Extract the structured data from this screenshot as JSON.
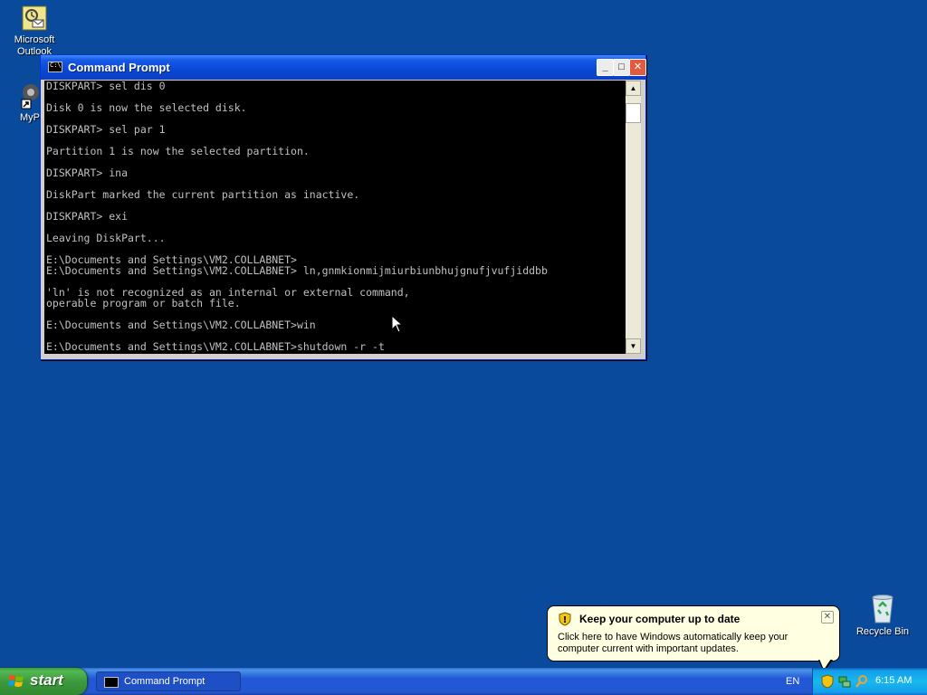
{
  "desktop": {
    "icons": [
      {
        "label": "Microsoft Outlook"
      },
      {
        "label": "MyPa"
      }
    ],
    "recycle_bin": {
      "label": "Recycle Bin"
    }
  },
  "window": {
    "title": "Command Prompt",
    "icon_text": "C:\\",
    "buttons": {
      "minimize": "_",
      "maximize": "□",
      "close": "✕"
    },
    "console_lines": [
      "DISKPART> sel dis 0",
      "",
      "Disk 0 is now the selected disk.",
      "",
      "DISKPART> sel par 1",
      "",
      "Partition 1 is now the selected partition.",
      "",
      "DISKPART> ina",
      "",
      "DiskPart marked the current partition as inactive.",
      "",
      "DISKPART> exi",
      "",
      "Leaving DiskPart...",
      "",
      "E:\\Documents and Settings\\VM2.COLLABNET>",
      "E:\\Documents and Settings\\VM2.COLLABNET> ln,gnmkionmijmiurbiunbhujgnufjvufjiddbb",
      "",
      "'ln' is not recognized as an internal or external command,",
      "operable program or batch file.",
      "",
      "E:\\Documents and Settings\\VM2.COLLABNET>win",
      "",
      "E:\\Documents and Settings\\VM2.COLLABNET>shutdown -r -t"
    ]
  },
  "balloon": {
    "title": "Keep your computer up to date",
    "body": "Click here to have Windows automatically keep your computer current with important updates.",
    "close": "✕"
  },
  "taskbar": {
    "start_label": "start",
    "task_items": [
      {
        "label": "Command Prompt"
      }
    ],
    "language": "EN",
    "clock": "6:15 AM"
  }
}
